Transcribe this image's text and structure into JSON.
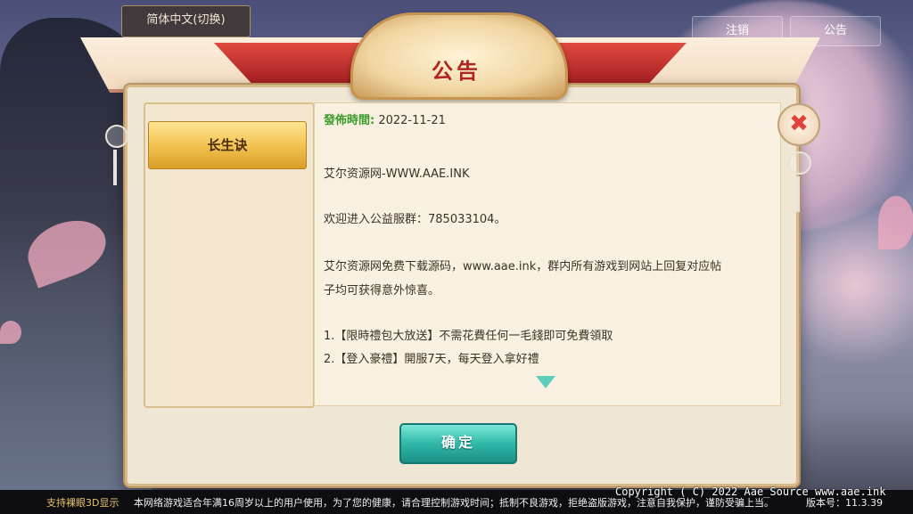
{
  "top_bar": {
    "language_label": "简体中文(切换)",
    "logout_label": "注销",
    "notice_label": "公告"
  },
  "panel": {
    "title": "公告",
    "list": [
      {
        "label": "长生诀"
      }
    ],
    "content": {
      "date_label": "發佈時間:",
      "date_value": "2022-11-21",
      "lines": [
        "艾尔资源网-WWW.AAE.INK",
        "欢迎进入公益服群：785033104。",
        "艾尔资源网免费下载源码，www.aae.ink，群内所有游戏到网站上回复对应帖",
        "子均可获得意外惊喜。",
        "1.【限時禮包大放送】不需花費任何一毛錢即可免費領取",
        "2.【登入豪禮】開服7天，每天登入拿好禮"
      ]
    },
    "confirm_label": "确定",
    "close_symbol": "✖"
  },
  "footer": {
    "left_label": "支持裸眼3D显示",
    "health_notice": "本网络游戏适合年满16周岁以上的用户使用，为了您的健康，请合理控制游戏时间；抵制不良游戏，拒绝盗版游戏，注意自我保护，谨防受骗上当。",
    "version": "版本号：11.3.39",
    "copyright": "Copyright ( C) 2022 Aae_Source www.aae.ink"
  },
  "colors": {
    "accent_teal": "#2fb8a8",
    "title_red": "#b0251f",
    "date_green": "#3a9a2a",
    "tab_gold": "#f1c04d"
  }
}
